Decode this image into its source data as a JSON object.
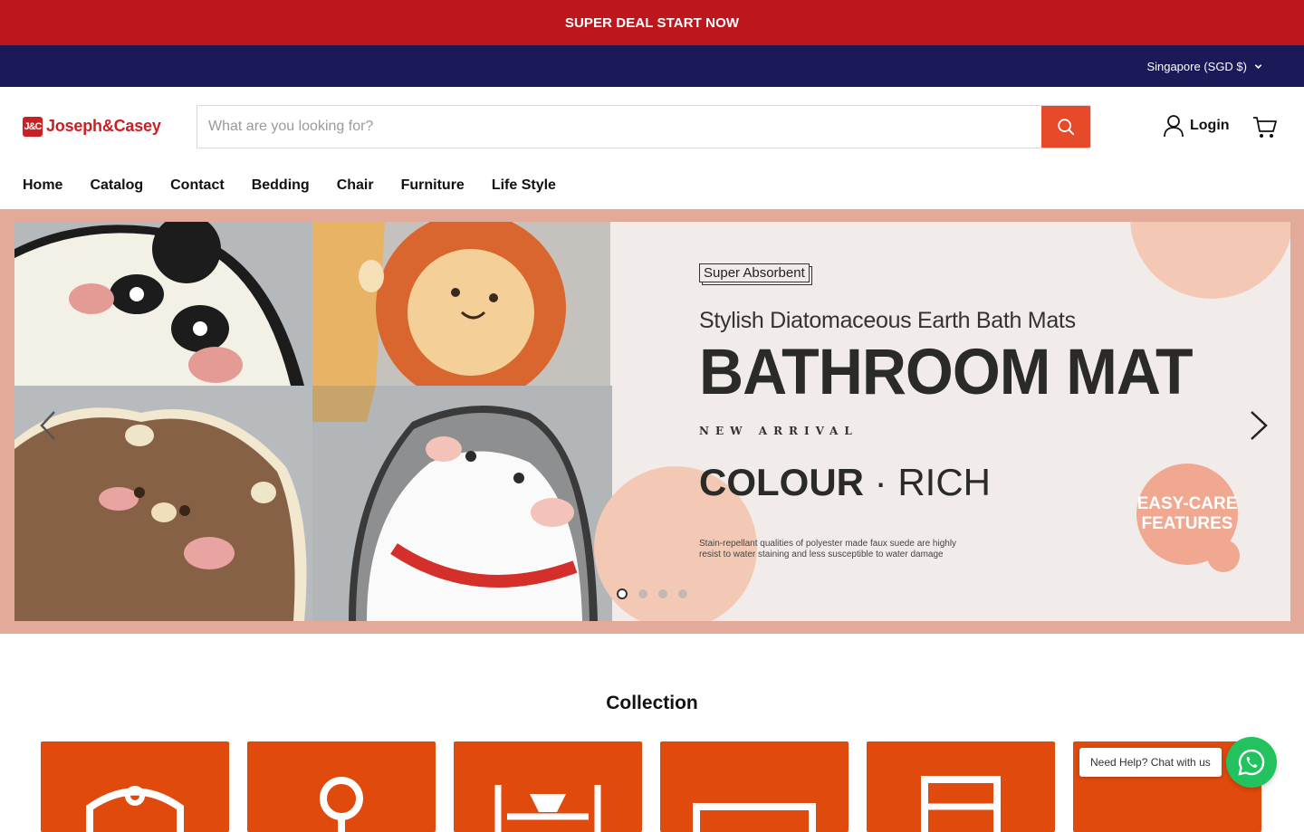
{
  "promo_bar": {
    "text": "SUPER DEAL START NOW"
  },
  "utility_bar": {
    "currency": "Singapore (SGD $)"
  },
  "header": {
    "logo_text": "Joseph&Casey",
    "search_placeholder": "What are you looking for?",
    "login_label": "Login"
  },
  "nav": {
    "items": [
      "Home",
      "Catalog",
      "Contact",
      "Bedding",
      "Chair",
      "Furniture",
      "Life Style"
    ]
  },
  "hero": {
    "badge": "Super Absorbent",
    "subtitle": "Stylish Diatomaceous Earth Bath Mats",
    "headline": "BATHROOM MAT",
    "tagline": "NEW ARRIVAL",
    "colour_bold": "COLOUR",
    "colour_light": "RICH",
    "fine_print": "Stain-repellant qualities of polyester made faux suede are highly resist to water staining and less susceptible to water damage",
    "easy_care": "EASY-CARE FEATURES",
    "active_slide": 1,
    "slide_count": 4
  },
  "collection": {
    "title": "Collection"
  },
  "chat": {
    "label": "Need Help? Chat with us"
  },
  "colors": {
    "promo": "#bd161c",
    "utility": "#1b1958",
    "accent": "#e64a2b",
    "hero_bg": "#e4aa99",
    "card": "#e04a0d",
    "whatsapp": "#22c35e"
  }
}
